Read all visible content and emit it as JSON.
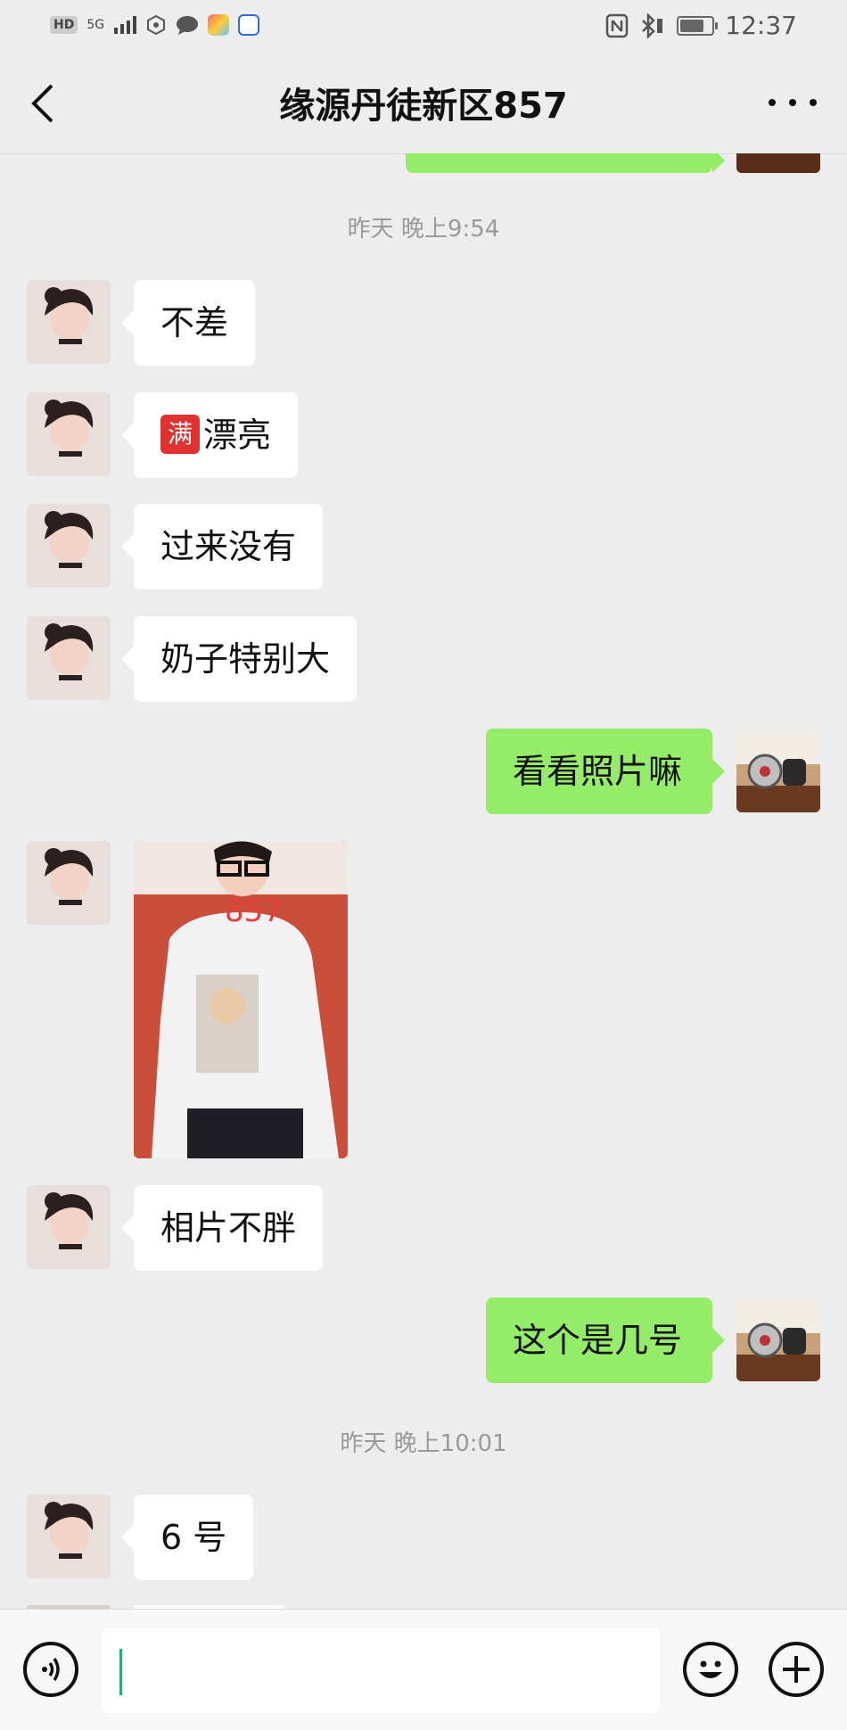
{
  "status_bar": {
    "hd": "HD",
    "signal": "5G",
    "time": "12:37"
  },
  "header": {
    "title": "缘源丹徒新区857"
  },
  "timestamps": [
    "昨天 晚上9:54",
    "昨天 晚上10:01"
  ],
  "messages": [
    {
      "side": "left",
      "text": "不差"
    },
    {
      "side": "left",
      "emoji": "满",
      "text": "漂亮"
    },
    {
      "side": "left",
      "text": "过来没有"
    },
    {
      "side": "left",
      "text": "奶子特别大"
    },
    {
      "side": "right",
      "text": "看看照片嘛"
    },
    {
      "side": "left",
      "photo_label": "857"
    },
    {
      "side": "left",
      "text": "相片不胖"
    },
    {
      "side": "right",
      "text": "这个是几号"
    },
    {
      "side": "left",
      "text": "6 号"
    }
  ],
  "colors": {
    "bg": "#ededed",
    "bubble_in": "#ffffff",
    "bubble_out": "#95ec69",
    "cursor": "#2aae67"
  },
  "icons": [
    "back-chevron-icon",
    "more-dots-icon",
    "voice-icon",
    "emoji-icon",
    "plus-icon"
  ]
}
